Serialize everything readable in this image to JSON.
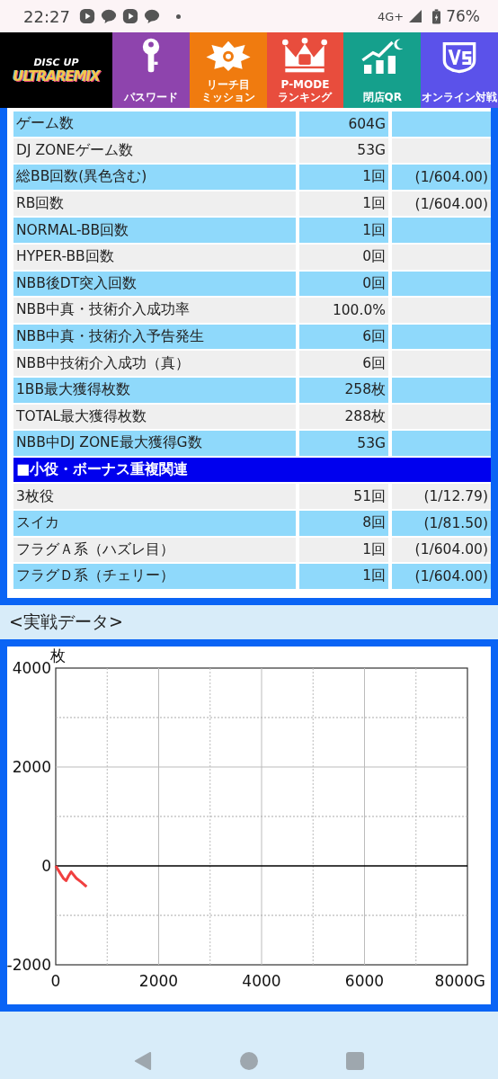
{
  "status_bar": {
    "time": "22:27",
    "network": "4G+",
    "battery": "76%"
  },
  "header": {
    "logo": {
      "top": "DISC UP",
      "bottom": "ULTRAREMIX"
    },
    "items": [
      {
        "kind": "key",
        "lines": [
          "パスワード"
        ],
        "color": "#8e44ad"
      },
      {
        "kind": "badge",
        "lines": [
          "リーチ目",
          "ミッション"
        ],
        "color": "#f07b0f"
      },
      {
        "kind": "crown",
        "lines": [
          "P-MODE",
          "ランキング"
        ],
        "color": "#e84d3d"
      },
      {
        "kind": "growth",
        "lines": [
          "閉店QR"
        ],
        "color": "#15a08c"
      },
      {
        "kind": "vs",
        "lines": [
          "オンライン対戦"
        ],
        "color": "#5b52ea"
      }
    ]
  },
  "table": {
    "rows": [
      {
        "kind": "data",
        "label": "ゲーム数",
        "value": "604G"
      },
      {
        "kind": "data",
        "label": "DJ ZONEゲーム数",
        "value": "53G"
      },
      {
        "kind": "data",
        "label": "総BB回数(異色含む)",
        "value": "1回",
        "ratio": "(1/604.00)"
      },
      {
        "kind": "data",
        "label": "RB回数",
        "value": "1回",
        "ratio": "(1/604.00)"
      },
      {
        "kind": "data",
        "label": "NORMAL-BB回数",
        "value": "1回"
      },
      {
        "kind": "data",
        "label": "HYPER-BB回数",
        "value": "0回"
      },
      {
        "kind": "data",
        "label": "NBB後DT突入回数",
        "value": "0回"
      },
      {
        "kind": "data",
        "label": "NBB中真・技術介入成功率",
        "value": "100.0%"
      },
      {
        "kind": "data",
        "label": "NBB中真・技術介入予告発生",
        "value": "6回"
      },
      {
        "kind": "data",
        "label": "NBB中技術介入成功（真）",
        "value": "6回"
      },
      {
        "kind": "data",
        "label": "1BB最大獲得枚数",
        "value": "258枚"
      },
      {
        "kind": "data",
        "label": "TOTAL最大獲得枚数",
        "value": "288枚"
      },
      {
        "kind": "data",
        "label": "NBB中DJ ZONE最大獲得G数",
        "value": "53G"
      },
      {
        "kind": "section",
        "label": "■小役・ボーナス重複関連"
      },
      {
        "kind": "data",
        "label": "3枚役",
        "value": "51回",
        "ratio": "(1/12.79)"
      },
      {
        "kind": "data",
        "label": "スイカ",
        "value": "8回",
        "ratio": "(1/81.50)"
      },
      {
        "kind": "data",
        "label": "フラグＡ系（ハズレ目）",
        "value": "1回",
        "ratio": "(1/604.00)"
      },
      {
        "kind": "data",
        "label": "フラグＤ系（チェリー）",
        "value": "1回",
        "ratio": "(1/604.00)"
      }
    ]
  },
  "section_title": "<実戦データ>",
  "chart": {
    "chart_data": {
      "type": "line",
      "ylabel": "枚",
      "x": [
        0,
        100,
        150,
        200,
        250,
        300,
        400,
        500,
        600
      ],
      "series": [
        {
          "color": "#f04040",
          "values": [
            0,
            -170,
            -250,
            -300,
            -200,
            -120,
            -250,
            -330,
            -420
          ]
        }
      ],
      "xlim": [
        0,
        8000
      ],
      "ylim": [
        -2000,
        4000
      ],
      "xticks": [
        0,
        2000,
        4000,
        6000,
        {
          "value": 8000,
          "label": "8000G"
        }
      ],
      "yticks": [
        -2000,
        0,
        2000,
        4000
      ],
      "grid": true
    }
  }
}
